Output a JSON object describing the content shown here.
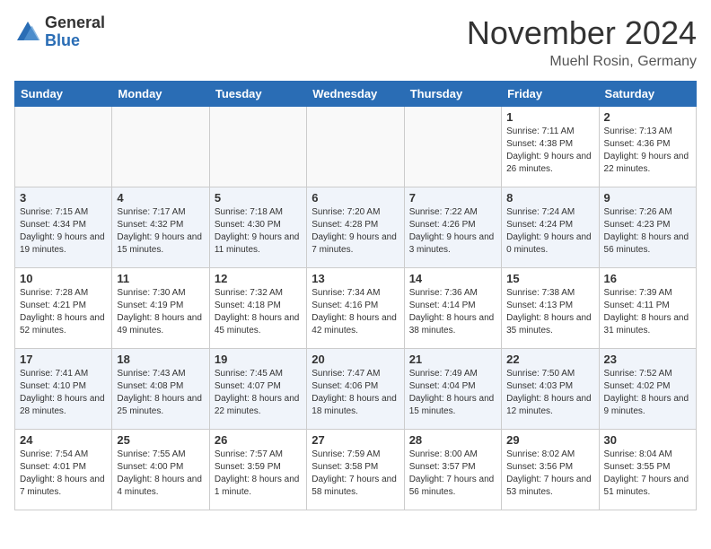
{
  "logo": {
    "general": "General",
    "blue": "Blue"
  },
  "title": "November 2024",
  "location": "Muehl Rosin, Germany",
  "days_of_week": [
    "Sunday",
    "Monday",
    "Tuesday",
    "Wednesday",
    "Thursday",
    "Friday",
    "Saturday"
  ],
  "weeks": [
    [
      {
        "day": "",
        "info": ""
      },
      {
        "day": "",
        "info": ""
      },
      {
        "day": "",
        "info": ""
      },
      {
        "day": "",
        "info": ""
      },
      {
        "day": "",
        "info": ""
      },
      {
        "day": "1",
        "info": "Sunrise: 7:11 AM\nSunset: 4:38 PM\nDaylight: 9 hours and 26 minutes."
      },
      {
        "day": "2",
        "info": "Sunrise: 7:13 AM\nSunset: 4:36 PM\nDaylight: 9 hours and 22 minutes."
      }
    ],
    [
      {
        "day": "3",
        "info": "Sunrise: 7:15 AM\nSunset: 4:34 PM\nDaylight: 9 hours and 19 minutes."
      },
      {
        "day": "4",
        "info": "Sunrise: 7:17 AM\nSunset: 4:32 PM\nDaylight: 9 hours and 15 minutes."
      },
      {
        "day": "5",
        "info": "Sunrise: 7:18 AM\nSunset: 4:30 PM\nDaylight: 9 hours and 11 minutes."
      },
      {
        "day": "6",
        "info": "Sunrise: 7:20 AM\nSunset: 4:28 PM\nDaylight: 9 hours and 7 minutes."
      },
      {
        "day": "7",
        "info": "Sunrise: 7:22 AM\nSunset: 4:26 PM\nDaylight: 9 hours and 3 minutes."
      },
      {
        "day": "8",
        "info": "Sunrise: 7:24 AM\nSunset: 4:24 PM\nDaylight: 9 hours and 0 minutes."
      },
      {
        "day": "9",
        "info": "Sunrise: 7:26 AM\nSunset: 4:23 PM\nDaylight: 8 hours and 56 minutes."
      }
    ],
    [
      {
        "day": "10",
        "info": "Sunrise: 7:28 AM\nSunset: 4:21 PM\nDaylight: 8 hours and 52 minutes."
      },
      {
        "day": "11",
        "info": "Sunrise: 7:30 AM\nSunset: 4:19 PM\nDaylight: 8 hours and 49 minutes."
      },
      {
        "day": "12",
        "info": "Sunrise: 7:32 AM\nSunset: 4:18 PM\nDaylight: 8 hours and 45 minutes."
      },
      {
        "day": "13",
        "info": "Sunrise: 7:34 AM\nSunset: 4:16 PM\nDaylight: 8 hours and 42 minutes."
      },
      {
        "day": "14",
        "info": "Sunrise: 7:36 AM\nSunset: 4:14 PM\nDaylight: 8 hours and 38 minutes."
      },
      {
        "day": "15",
        "info": "Sunrise: 7:38 AM\nSunset: 4:13 PM\nDaylight: 8 hours and 35 minutes."
      },
      {
        "day": "16",
        "info": "Sunrise: 7:39 AM\nSunset: 4:11 PM\nDaylight: 8 hours and 31 minutes."
      }
    ],
    [
      {
        "day": "17",
        "info": "Sunrise: 7:41 AM\nSunset: 4:10 PM\nDaylight: 8 hours and 28 minutes."
      },
      {
        "day": "18",
        "info": "Sunrise: 7:43 AM\nSunset: 4:08 PM\nDaylight: 8 hours and 25 minutes."
      },
      {
        "day": "19",
        "info": "Sunrise: 7:45 AM\nSunset: 4:07 PM\nDaylight: 8 hours and 22 minutes."
      },
      {
        "day": "20",
        "info": "Sunrise: 7:47 AM\nSunset: 4:06 PM\nDaylight: 8 hours and 18 minutes."
      },
      {
        "day": "21",
        "info": "Sunrise: 7:49 AM\nSunset: 4:04 PM\nDaylight: 8 hours and 15 minutes."
      },
      {
        "day": "22",
        "info": "Sunrise: 7:50 AM\nSunset: 4:03 PM\nDaylight: 8 hours and 12 minutes."
      },
      {
        "day": "23",
        "info": "Sunrise: 7:52 AM\nSunset: 4:02 PM\nDaylight: 8 hours and 9 minutes."
      }
    ],
    [
      {
        "day": "24",
        "info": "Sunrise: 7:54 AM\nSunset: 4:01 PM\nDaylight: 8 hours and 7 minutes."
      },
      {
        "day": "25",
        "info": "Sunrise: 7:55 AM\nSunset: 4:00 PM\nDaylight: 8 hours and 4 minutes."
      },
      {
        "day": "26",
        "info": "Sunrise: 7:57 AM\nSunset: 3:59 PM\nDaylight: 8 hours and 1 minute."
      },
      {
        "day": "27",
        "info": "Sunrise: 7:59 AM\nSunset: 3:58 PM\nDaylight: 7 hours and 58 minutes."
      },
      {
        "day": "28",
        "info": "Sunrise: 8:00 AM\nSunset: 3:57 PM\nDaylight: 7 hours and 56 minutes."
      },
      {
        "day": "29",
        "info": "Sunrise: 8:02 AM\nSunset: 3:56 PM\nDaylight: 7 hours and 53 minutes."
      },
      {
        "day": "30",
        "info": "Sunrise: 8:04 AM\nSunset: 3:55 PM\nDaylight: 7 hours and 51 minutes."
      }
    ]
  ]
}
